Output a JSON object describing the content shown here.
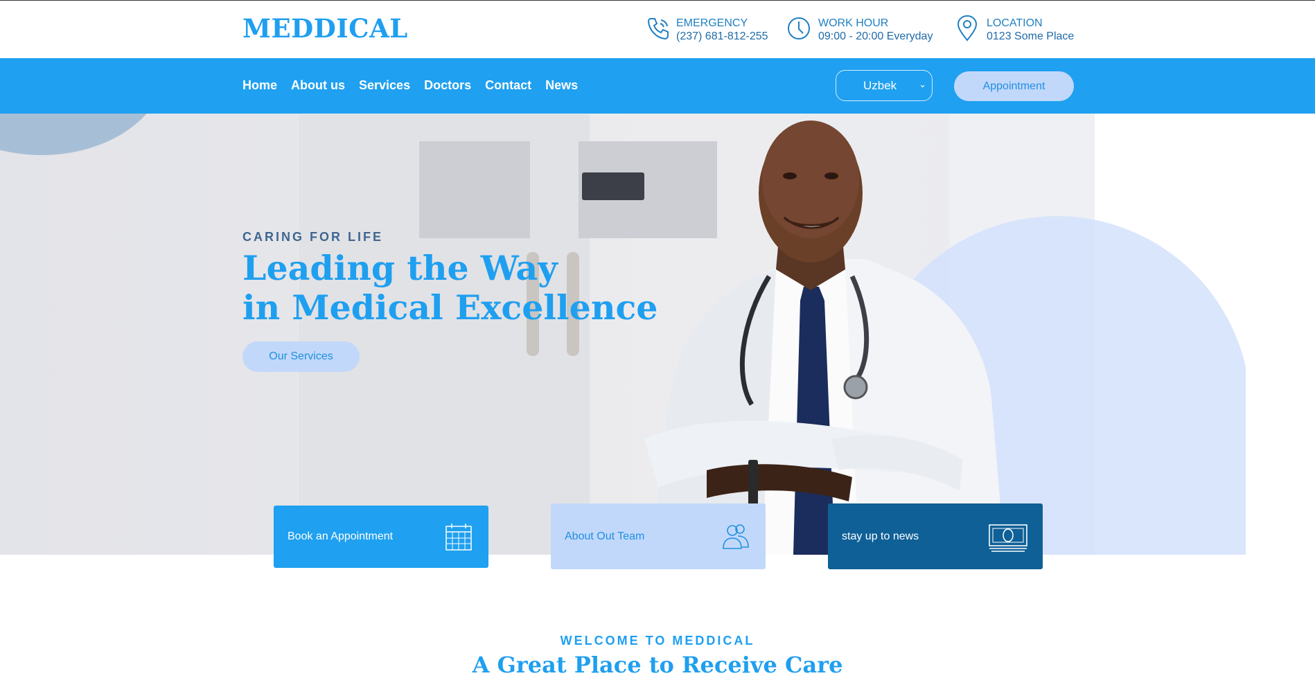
{
  "brand": {
    "logo": "MEDDICAL"
  },
  "header_info": [
    {
      "key": "EMERGENCY",
      "value": "(237) 681-812-255",
      "icon": "phone-icon"
    },
    {
      "key": "WORK HOUR",
      "value": "09:00 - 20:00 Everyday",
      "icon": "clock-icon"
    },
    {
      "key": "LOCATION",
      "value": "0123 Some Place",
      "icon": "location-pin-icon"
    }
  ],
  "nav": {
    "items": [
      "Home",
      "About us",
      "Services",
      "Doctors",
      "Contact",
      "News"
    ],
    "language": "Uzbek",
    "appointment": "Appointment"
  },
  "hero": {
    "eyebrow": "CARING FOR LIFE",
    "title_line1": "Leading the Way",
    "title_line2": "in Medical Excellence",
    "cta": "Our Services"
  },
  "cards": [
    {
      "title": "Book an Appointment",
      "icon": "calendar-icon"
    },
    {
      "title": "About Out Team",
      "icon": "team-icon"
    },
    {
      "title": "stay up to news",
      "icon": "money-icon"
    }
  ],
  "welcome": {
    "eyebrow": "WELCOME TO MEDDICAL",
    "title": "A Great Place to Receive Care"
  },
  "colors": {
    "primary": "#1fa0f0",
    "accent_light": "#c2d8fb",
    "dark": "#0e6097",
    "text_blue": "#1f7fc2"
  }
}
